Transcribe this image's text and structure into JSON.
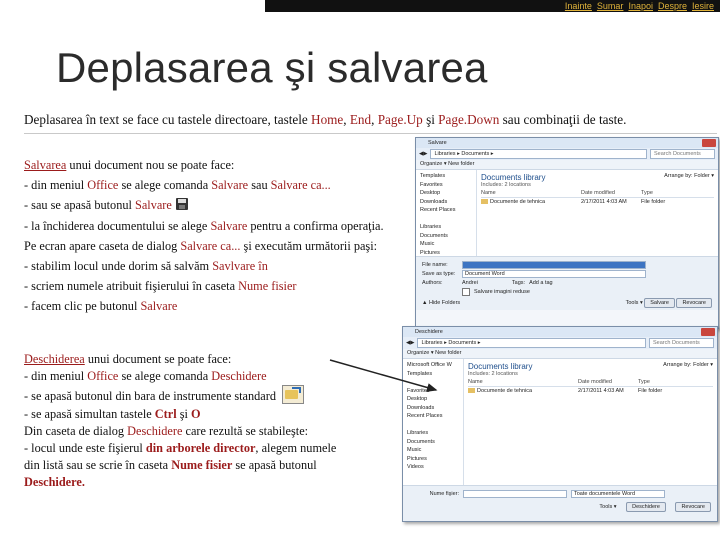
{
  "nav": [
    "Inainte",
    "Sumar",
    "Inapoi",
    "Despre",
    "Iesire"
  ],
  "title": "Deplasarea şi salvarea",
  "intro": {
    "pre": "Deplasarea în text se face cu tastele directoare, tastele ",
    "home": "Home",
    "c1": ", ",
    "end": "End",
    "c2": ", ",
    "pageup": "Page.Up",
    "and": " şi ",
    "pagedown": "Page.Down",
    "post": " sau combinaţii de taste."
  },
  "save_section": {
    "l1_link": "Salvarea",
    "l1_rest": " unui  document nou  se poate face:",
    "l2_pre": " - din meniul  ",
    "l2_office": "Office",
    "l2_mid": " se alege comanda ",
    "l2_salvare": "Salvare",
    "l2_sau": " sau ",
    "l2_salvareca": "Salvare ca...",
    "l3_pre": " -  sau se apasă butonul ",
    "l3_salvare": "Salvare",
    "l4_pre": " - la închiderea documentului se alege ",
    "l4_salvare": "Salvare",
    "l4_post": " pentru a confirma operaţia.",
    "l5_pre": "Pe ecran apare caseta de dialog ",
    "l5_salvareca": "Salvare ca...",
    "l5_post": "  şi executăm următorii paşi:",
    "l6_pre": "- stabilim locul unde dorim să salvăm ",
    "l6_red": "Savlvare în",
    "l7_pre": "- scriem numele atribuit fişierului în caseta  ",
    "l7_red": "Nume fisier",
    "l8_pre": "- facem clic pe butonul ",
    "l8_red": "Salvare"
  },
  "open_section": {
    "l1_link": "Deschiderea",
    "l1_rest": " unui document se poate face:",
    "l2_pre": "- din meniul ",
    "l2_office": "Office",
    "l2_mid": " se alege comanda ",
    "l2_red": "Deschidere",
    "l3_pre": "-  se apasă butonul din bara de instrumente standard",
    "l4_pre": "- se apasă simultan tastele ",
    "l4_ctrl": "Ctrl",
    "l4_si": " şi ",
    "l4_o": "O",
    "l5_pre": "Din caseta de dialog ",
    "l5_red": "Deschidere",
    "l5_post": " care rezultă se stabileşte:",
    "l6_pre": " - locul unde este fişierul ",
    "l6_red": "din arborele director",
    "l6_post": ", alegem numele",
    "l7_pre": "din listă sau se scrie în caseta ",
    "l7_red": "Nume fisier",
    "l7_post": " se apasă butonul",
    "l8_red": "Deschidere."
  },
  "save_window": {
    "title": "Salvare",
    "address": "Libraries ▸ Documents ▸",
    "search": "Search Documents",
    "toolbar": "Organize ▾   New folder",
    "nav_items": [
      "Templates",
      "Favorites",
      "Desktop",
      "Downloads",
      "Recent Places",
      "",
      "Libraries",
      "Documents",
      "Music",
      "Pictures",
      "Videos"
    ],
    "lib_title": "Documents library",
    "lib_sub": "Includes: 2 locations",
    "arrange": "Arrange by:  Folder ▾",
    "col_name": "Name",
    "col_date": "Date modified",
    "col_type": "Type",
    "file_name": "Documente de tehnica",
    "file_date": "2/17/2011 4:03 AM",
    "file_type": "File folder",
    "label_filename": "File name:",
    "label_type": "Save as type:",
    "type_value": "Document Word",
    "label_authors": "Authors:",
    "authors_value": "Andrei",
    "label_tags": "Tags:",
    "tags_value": "Add a tag",
    "thumb": "Salvare imagini reduse",
    "hide": "▲ Hide Folders",
    "tools": "Tools ▾",
    "save_btn": "Salvare",
    "cancel_btn": "Revocare"
  },
  "open_window": {
    "title": "Deschidere",
    "address": "Libraries ▸ Documents ▸",
    "search": "Search Documents",
    "toolbar": "Organize ▾   New folder",
    "nav_items": [
      "Microsoft Office W",
      "Templates",
      "",
      "Favorites",
      "Desktop",
      "Downloads",
      "Recent Places",
      "",
      "Libraries",
      "Documents",
      "Music",
      "Pictures",
      "Videos"
    ],
    "lib_title": "Documents library",
    "lib_sub": "Includes: 2 locations",
    "arrange": "Arrange by:  Folder ▾",
    "col_name": "Name",
    "col_date": "Date modified",
    "col_type": "Type",
    "file_name": "Documente de tehnica",
    "file_date": "2/17/2011 4:03 AM",
    "file_type": "File folder",
    "label_filename": "Nume fişier:",
    "type_value": "Toate documentele Word",
    "tools": "Tools ▾",
    "open_btn": "Deschidere",
    "cancel_btn": "Revocare"
  }
}
